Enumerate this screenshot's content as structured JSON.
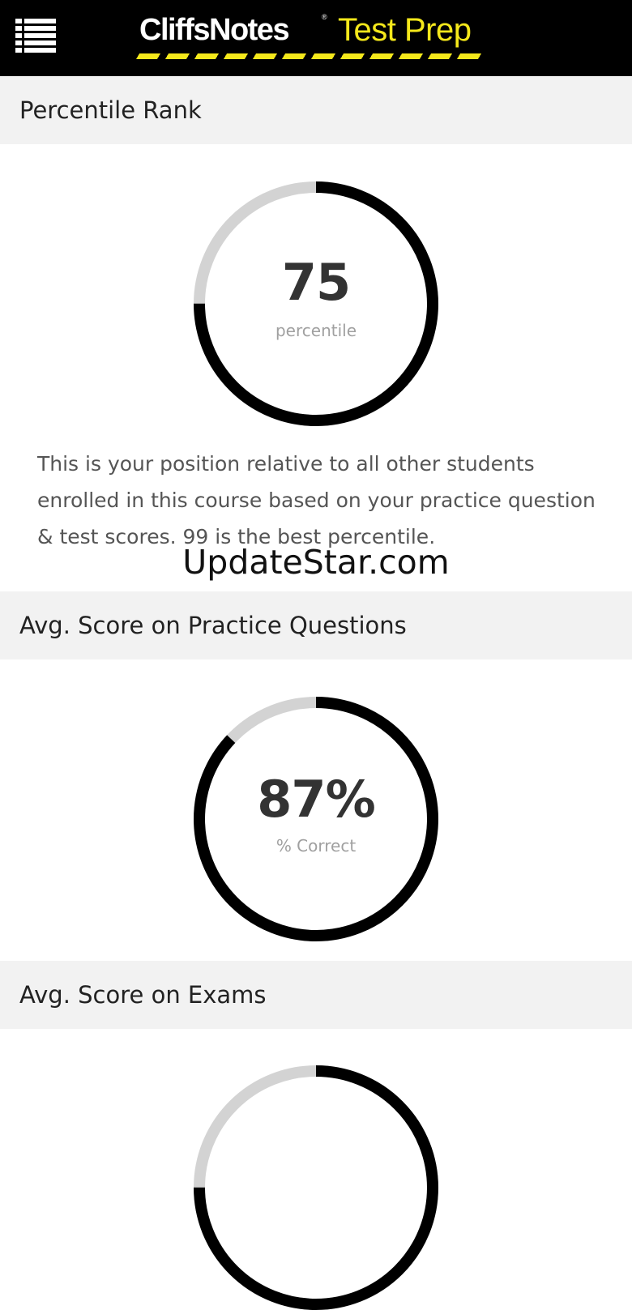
{
  "header": {
    "menu_icon": "list-menu-icon",
    "logo_primary": "CliffsNotes",
    "logo_registered": "®",
    "logo_secondary": "Test Prep",
    "colors": {
      "background": "#000000",
      "accent": "#f5e81b",
      "logo_text": "#ffffff"
    }
  },
  "sections": [
    {
      "title": "Percentile Rank",
      "value": "75",
      "value_label": "percentile",
      "ring_fill_fraction": 0.75,
      "description": "This is your position relative to all other students enrolled in this course based on your practice question & test scores. 99 is the best percentile."
    },
    {
      "title": "Avg. Score on Practice Questions",
      "value": "87%",
      "value_label": "% Correct",
      "ring_fill_fraction": 0.87
    },
    {
      "title": "Avg. Score on Exams",
      "ring_fill_fraction": 0.75
    }
  ],
  "watermark": "UpdateStar.com",
  "colors": {
    "ring_filled": "#000000",
    "ring_track": "#d3d3d3",
    "section_bg": "#f2f2f2"
  }
}
